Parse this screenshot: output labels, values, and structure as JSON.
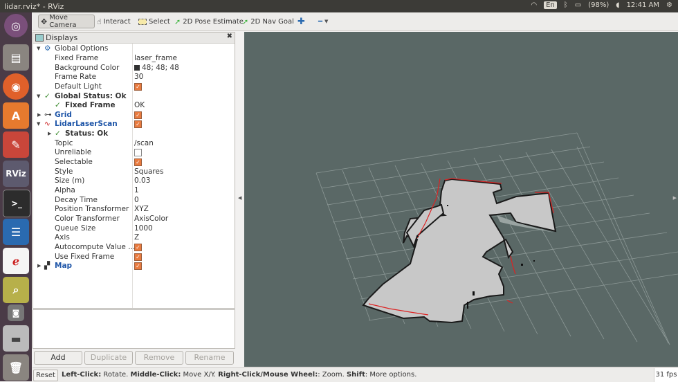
{
  "window": {
    "title": "lidar.rviz* - RViz"
  },
  "system": {
    "battery": "(98%)",
    "time": "12:41 AM",
    "lang": "En"
  },
  "toolbar": {
    "move_camera": "Move Camera",
    "interact": "Interact",
    "select": "Select",
    "pose_estimate": "2D Pose Estimate",
    "nav_goal": "2D Nav Goal"
  },
  "displays": {
    "title": "Displays",
    "global_options": "Global Options",
    "fixed_frame_label": "Fixed Frame",
    "fixed_frame_value": "laser_frame",
    "bg_color_label": "Background Color",
    "bg_color_value": "48; 48; 48",
    "frame_rate_label": "Frame Rate",
    "frame_rate_value": "30",
    "default_light_label": "Default Light",
    "global_status": "Global Status: Ok",
    "gs_fixed_frame": "Fixed Frame",
    "gs_fixed_frame_value": "OK",
    "grid": "Grid",
    "lidar": "LidarLaserScan",
    "status_ok": "Status: Ok",
    "topic_label": "Topic",
    "topic_value": "/scan",
    "unreliable_label": "Unreliable",
    "selectable_label": "Selectable",
    "style_label": "Style",
    "style_value": "Squares",
    "size_label": "Size (m)",
    "size_value": "0.03",
    "alpha_label": "Alpha",
    "alpha_value": "1",
    "decay_label": "Decay Time",
    "decay_value": "0",
    "pos_tf_label": "Position Transformer",
    "pos_tf_value": "XYZ",
    "color_tf_label": "Color Transformer",
    "color_tf_value": "AxisColor",
    "queue_label": "Queue Size",
    "queue_value": "1000",
    "axis_label": "Axis",
    "axis_value": "Z",
    "autocompute_label": "Autocompute Value ...",
    "use_fixed_label": "Use Fixed Frame",
    "map": "Map"
  },
  "buttons": {
    "add": "Add",
    "duplicate": "Duplicate",
    "remove": "Remove",
    "rename": "Rename"
  },
  "status": {
    "reset": "Reset",
    "help_1": "Left-Click:",
    "help_2": " Rotate. ",
    "help_3": "Middle-Click:",
    "help_4": " Move X/Y. ",
    "help_5": "Right-Click/Mouse Wheel:",
    "help_6": ": Zoom. ",
    "help_7": "Shift",
    "help_8": ": More options.",
    "fps": "31 fps"
  },
  "colors": {
    "launcher": "#4a3b47",
    "viewport": "#5a6866",
    "accent": "#e97b3f"
  }
}
